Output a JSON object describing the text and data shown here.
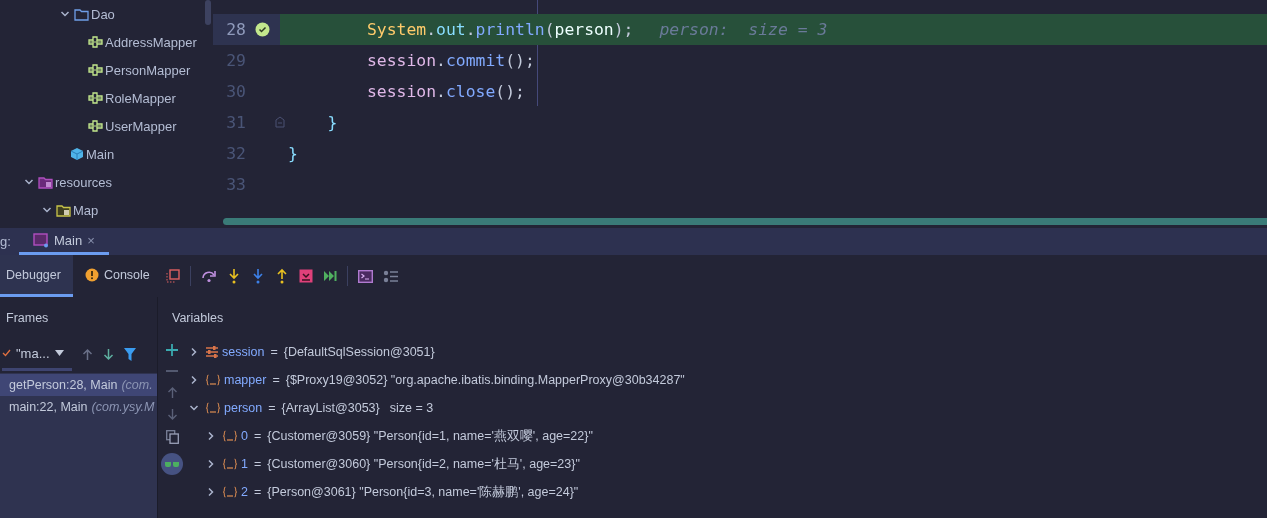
{
  "project_tree": [
    {
      "children": [
        {
          "children": [
            {
              "label": "Dao",
              "kind": "package",
              "expanded": true,
              "children": [
                {
                  "label": "AddressMapper",
                  "kind": "mapper"
                },
                {
                  "label": "PersonMapper",
                  "kind": "mapper"
                },
                {
                  "label": "RoleMapper",
                  "kind": "mapper"
                },
                {
                  "label": "UserMapper",
                  "kind": "mapper"
                }
              ]
            },
            {
              "label": "Main",
              "kind": "class"
            }
          ]
        }
      ]
    },
    {
      "label": "resources",
      "kind": "resources-root",
      "expanded": true,
      "children": [
        {
          "label": "Map",
          "kind": "resources-folder",
          "expanded": true
        }
      ]
    }
  ],
  "editor": {
    "lines": [
      {
        "number": "28",
        "kind": "statement",
        "breakpoint": true,
        "current": true,
        "tokens": [
          {
            "text": "System",
            "kind": "type"
          },
          {
            "text": ".",
            "kind": "punct"
          },
          {
            "text": "out",
            "kind": "field"
          },
          {
            "text": ".",
            "kind": "punct"
          },
          {
            "text": "println",
            "kind": "method"
          },
          {
            "text": "(",
            "kind": "punct"
          },
          {
            "text": "person",
            "kind": "ident"
          },
          {
            "text": ");",
            "kind": "punct"
          }
        ],
        "inline_hint": "person:  size = 3"
      },
      {
        "number": "29",
        "kind": "statement",
        "breakpoint": false,
        "current": false,
        "tokens": [
          {
            "text": "session",
            "kind": "local"
          },
          {
            "text": ".",
            "kind": "punct"
          },
          {
            "text": "commit",
            "kind": "method"
          },
          {
            "text": "();",
            "kind": "punct"
          }
        ]
      },
      {
        "number": "30",
        "kind": "statement",
        "breakpoint": false,
        "current": false,
        "tokens": [
          {
            "text": "session",
            "kind": "local"
          },
          {
            "text": ".",
            "kind": "punct"
          },
          {
            "text": "close",
            "kind": "method"
          },
          {
            "text": "();",
            "kind": "punct"
          }
        ]
      },
      {
        "number": "31",
        "kind": "method-end",
        "breakpoint": false,
        "current": false,
        "fold": true,
        "tokens": [
          {
            "text": "}",
            "kind": "brace"
          }
        ]
      },
      {
        "number": "32",
        "kind": "class-end",
        "breakpoint": false,
        "current": false,
        "tokens": [
          {
            "text": "}",
            "kind": "brace"
          }
        ]
      },
      {
        "number": "33",
        "kind": "blank",
        "breakpoint": false,
        "current": false
      }
    ]
  },
  "debug": {
    "title": "g:",
    "tabs": [
      {
        "label": "Main",
        "selected": true,
        "close": "×"
      }
    ],
    "subtabs": [
      {
        "label": "Debugger",
        "selected": true,
        "kind": "plain"
      },
      {
        "label": "Console",
        "selected": false,
        "kind": "console"
      }
    ],
    "frames": {
      "header": "Frames",
      "thread": "\"ma...",
      "items": [
        {
          "method": "getPerson:28, Main",
          "location": "(com.",
          "selected": true
        },
        {
          "method": "main:22, Main",
          "location": "(com.ysy.M",
          "selected": false
        }
      ]
    },
    "variables": {
      "header": "Variables",
      "items": [
        {
          "name": "session",
          "equals": "=",
          "value": "{DefaultSqlSession@3051}",
          "kind": "settings",
          "expanded": false
        },
        {
          "name": "mapper",
          "equals": "=",
          "value": "{$Proxy19@3052} \"org.apache.ibatis.binding.MapperProxy@30b34287\"",
          "kind": "object",
          "expanded": false
        },
        {
          "name": "person",
          "equals": "=",
          "value": "{ArrayList@3053}",
          "extra": "size = 3",
          "kind": "object",
          "expanded": true,
          "children": [
            {
              "name": "0",
              "equals": "=",
              "value": "{Customer@3059} \"Person{id=1, name='燕双嘤', age=22}\"",
              "kind": "object",
              "expanded": false
            },
            {
              "name": "1",
              "equals": "=",
              "value": "{Customer@3060} \"Person{id=2, name='杜马', age=23}\"",
              "kind": "object",
              "expanded": false
            },
            {
              "name": "2",
              "equals": "=",
              "value": "{Person@3061} \"Person{id=3, name='陈赫鹏', age=24}\"",
              "kind": "object",
              "expanded": false
            }
          ]
        }
      ]
    }
  }
}
